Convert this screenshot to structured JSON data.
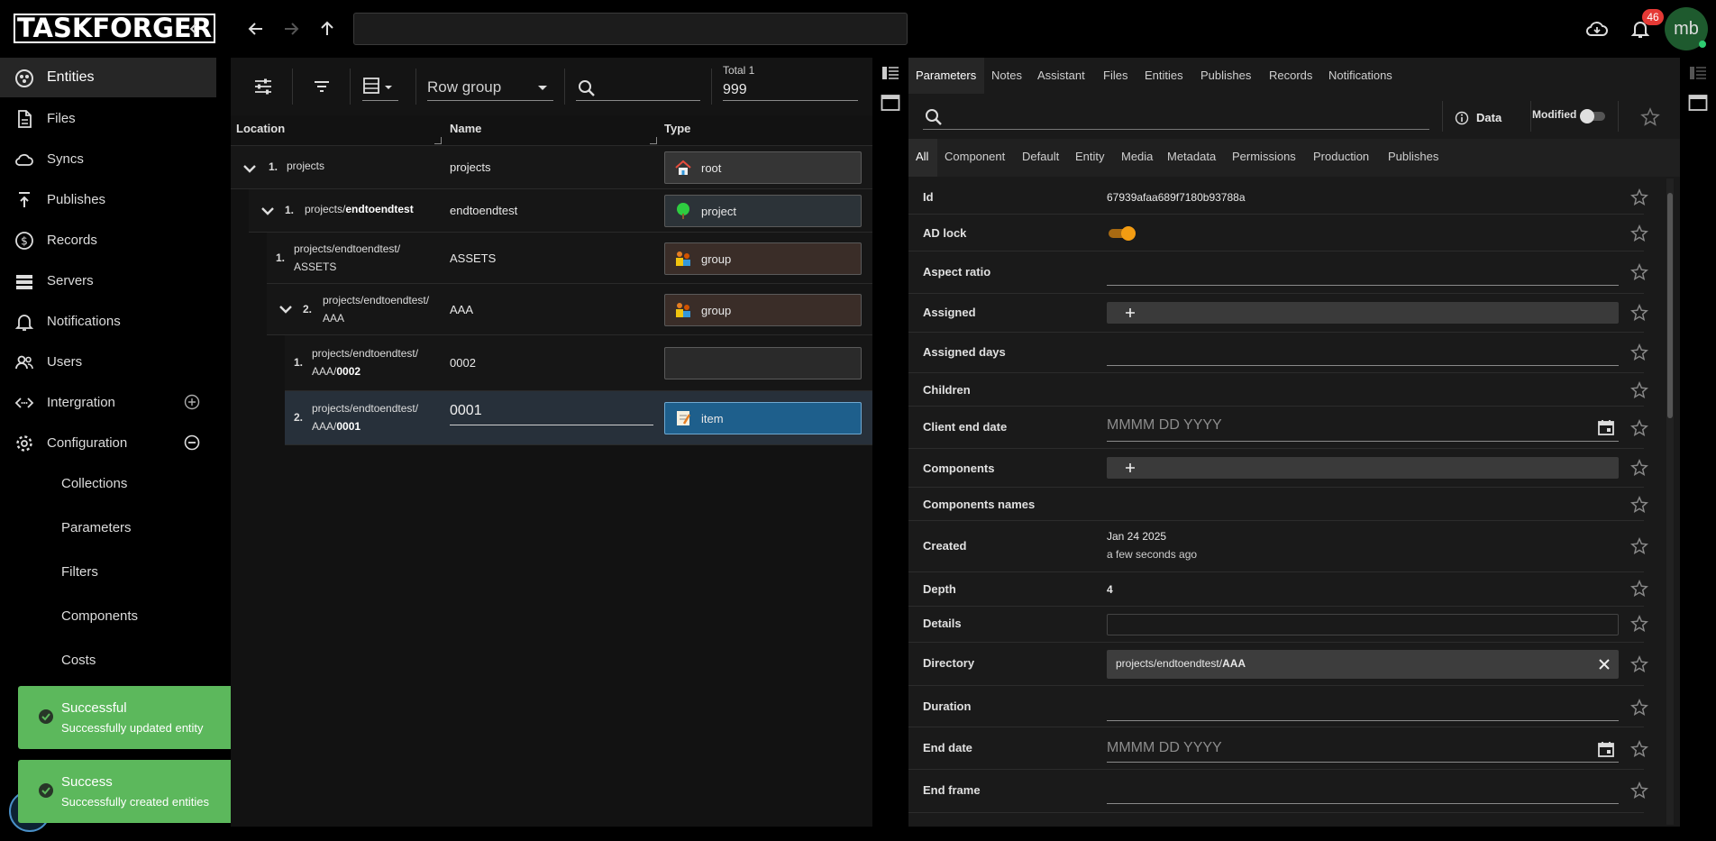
{
  "app": {
    "logo_text": "TASKFORGER"
  },
  "topbar": {
    "path_value": "",
    "notifications_count": "46",
    "avatar_initials": "mb"
  },
  "sidebar": {
    "items": [
      {
        "label": "Entities",
        "icon": "entities-icon"
      },
      {
        "label": "Files",
        "icon": "file-icon"
      },
      {
        "label": "Syncs",
        "icon": "cloud-sync-icon"
      },
      {
        "label": "Publishes",
        "icon": "publish-icon"
      },
      {
        "label": "Records",
        "icon": "dollar-icon"
      },
      {
        "label": "Servers",
        "icon": "server-icon"
      },
      {
        "label": "Notifications",
        "icon": "bell-icon"
      },
      {
        "label": "Users",
        "icon": "users-icon"
      },
      {
        "label": "Intergration",
        "icon": "integration-icon"
      },
      {
        "label": "Configuration",
        "icon": "gear-icon"
      }
    ],
    "subitems": [
      "Collections",
      "Parameters",
      "Filters",
      "Components",
      "Costs"
    ]
  },
  "toasts": [
    {
      "title": "Successful",
      "message": "Successfully updated entity"
    },
    {
      "title": "Success",
      "message": "Successfully created entities"
    }
  ],
  "grid": {
    "toolbar": {
      "row_group_placeholder": "Row group",
      "total_label": "Total 1",
      "total_value": "999"
    },
    "columns": [
      "Location",
      "Name",
      "Type"
    ],
    "rows": [
      {
        "num": "1.",
        "loc1": "projects",
        "loc2": "",
        "bold": "",
        "name": "projects",
        "type": "root"
      },
      {
        "num": "1.",
        "loc1": "projects/",
        "loc2": "",
        "bold": "endtoendtest",
        "name": "endtoendtest",
        "type": "project"
      },
      {
        "num": "1.",
        "loc1": "projects/endtoendtest/",
        "loc2": "",
        "bold": "ASSETS",
        "name": "ASSETS",
        "type": "group"
      },
      {
        "num": "2.",
        "loc1": "projects/endtoendtest/",
        "loc2": "",
        "bold": "AAA",
        "name": "AAA",
        "type": "group"
      },
      {
        "num": "1.",
        "loc1": "projects/endtoendtest/",
        "loc2": "AAA/",
        "bold": "0002",
        "name": "0002",
        "type": ""
      },
      {
        "num": "2.",
        "loc1": "projects/endtoendtest/",
        "loc2": "AAA/",
        "bold": "0001",
        "name": "0001",
        "type": "item"
      }
    ]
  },
  "right": {
    "tabs": [
      "Parameters",
      "Notes",
      "Assistant",
      "Files",
      "Entities",
      "Publishes",
      "Records",
      "Notifications"
    ],
    "data_label": "Data",
    "modified_label": "Modified",
    "subtabs": [
      "All",
      "Component",
      "Default",
      "Entity",
      "Media",
      "Metadata",
      "Permissions",
      "Production",
      "Publishes"
    ],
    "params": {
      "id_label": "Id",
      "id_value": "67939afaa689f7180b93788a",
      "adlock_label": "AD lock",
      "aspect_label": "Aspect ratio",
      "assigned_label": "Assigned",
      "assigned_days_label": "Assigned days",
      "children_label": "Children",
      "client_end_label": "Client end date",
      "client_end_placeholder": "MMMM DD YYYY",
      "components_label": "Components",
      "components_names_label": "Components names",
      "created_label": "Created",
      "created_date": "Jan 24 2025",
      "created_ago": "a few seconds ago",
      "depth_label": "Depth",
      "depth_value": "4",
      "details_label": "Details",
      "directory_label": "Directory",
      "directory_prefix": "projects/endtoendtest/",
      "directory_bold": "AAA",
      "duration_label": "Duration",
      "end_date_label": "End date",
      "end_date_placeholder": "MMMM DD YYYY",
      "end_frame_label": "End frame"
    }
  },
  "colors": {
    "accent_orange": "#f39c12",
    "toast_green": "#5cb85c",
    "selected_blue": "#1e5f8c",
    "badge_red": "#e53935"
  }
}
